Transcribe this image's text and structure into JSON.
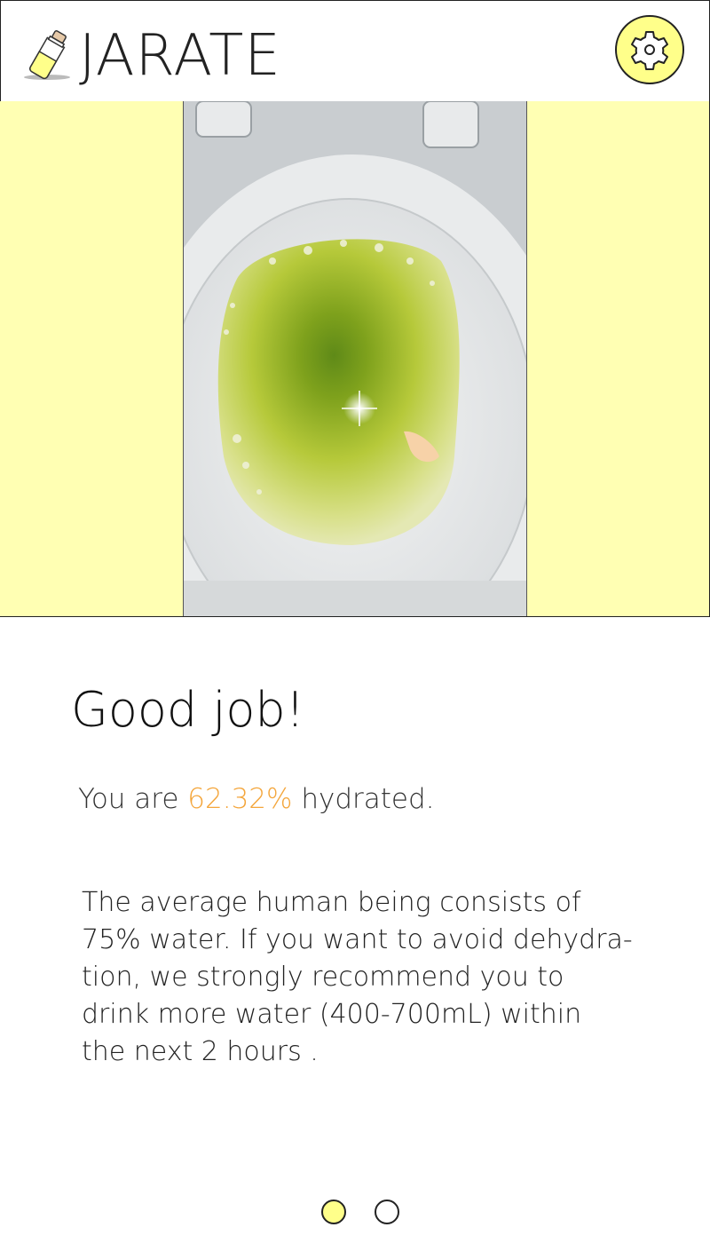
{
  "header": {
    "app_title": "JARATE",
    "logo_icon": "urine-bottle-icon",
    "settings_icon": "gear-icon",
    "colors": {
      "accent_yellow": "#ffff8a"
    }
  },
  "photo": {
    "subject": "toilet-bowl-sample-photo",
    "band_color": "#ffffb3"
  },
  "result": {
    "headline": "Good job!",
    "hydration_prefix": "You are ",
    "hydration_value": "62.32%",
    "hydration_suffix": " hydrated.",
    "hydration_color": "#f4a63c",
    "advice_lines": [
      "The average human being consists of",
      "75% water. If you want to avoid dehydra-",
      "tion, we strongly recommend you to",
      "drink more water (400-700mL) within",
      "the next 2 hours ."
    ]
  },
  "pager": {
    "count": 2,
    "active_index": 0
  }
}
